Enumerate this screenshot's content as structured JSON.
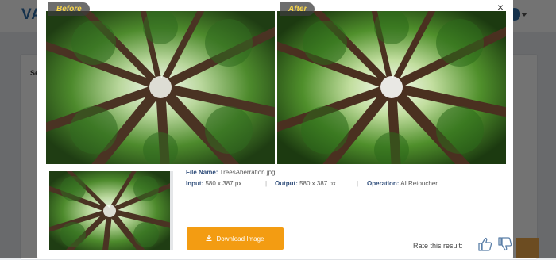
{
  "background": {
    "logo": "VA",
    "card_label": "Se"
  },
  "modal": {
    "close_label": "×",
    "before_label": "Before",
    "after_label": "After",
    "file": {
      "name_label": "File Name:",
      "name_value": "TreesAberration.jpg",
      "input_label": "Input:",
      "input_value": "580 x 387 px",
      "output_label": "Output:",
      "output_value": "580 x 387 px",
      "operation_label": "Operation:",
      "operation_value": "AI Retoucher",
      "separator": "|"
    },
    "download_label": "Download Image",
    "download_icon": "download-icon",
    "rate_label": "Rate this result:",
    "thumbs_up_icon": "thumbs-up-icon",
    "thumbs_down_icon": "thumbs-down-icon"
  },
  "colors": {
    "accent_orange": "#f39c12",
    "label_blue": "#2f4d7a",
    "tag_yellow": "#f7d54a"
  }
}
